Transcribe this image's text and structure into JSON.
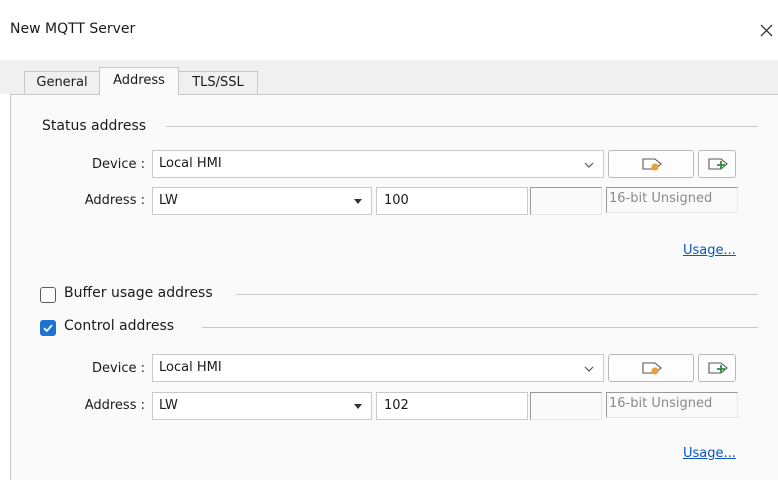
{
  "window": {
    "title": "New MQTT Server"
  },
  "tabs": [
    {
      "label": "General",
      "active": false
    },
    {
      "label": "Address",
      "active": true
    },
    {
      "label": "TLS/SSL",
      "active": false
    }
  ],
  "status_group": {
    "title": "Status address",
    "device_label": "Device :",
    "device_value": "Local HMI",
    "address_label": "Address :",
    "address_type": "LW",
    "address_value": "100",
    "address_index": "",
    "data_format": "16-bit Unsigned",
    "usage_link": "Usage..."
  },
  "buffer_group": {
    "title": "Buffer usage address",
    "checked": false
  },
  "control_group": {
    "title": "Control address",
    "checked": true,
    "device_label": "Device :",
    "device_value": "Local HMI",
    "address_label": "Address :",
    "address_type": "LW",
    "address_value": "102",
    "address_index": "",
    "data_format": "16-bit Unsigned",
    "usage_link": "Usage..."
  },
  "icons": {
    "close": "close-icon",
    "device_settings": "tag-settings-icon",
    "new_device": "add-tag-icon",
    "check": "check-icon"
  },
  "colors": {
    "accent": "#1e73d2",
    "link": "#0a56c2",
    "icon_orange": "#e8a03a",
    "icon_green": "#2e8b3a"
  }
}
